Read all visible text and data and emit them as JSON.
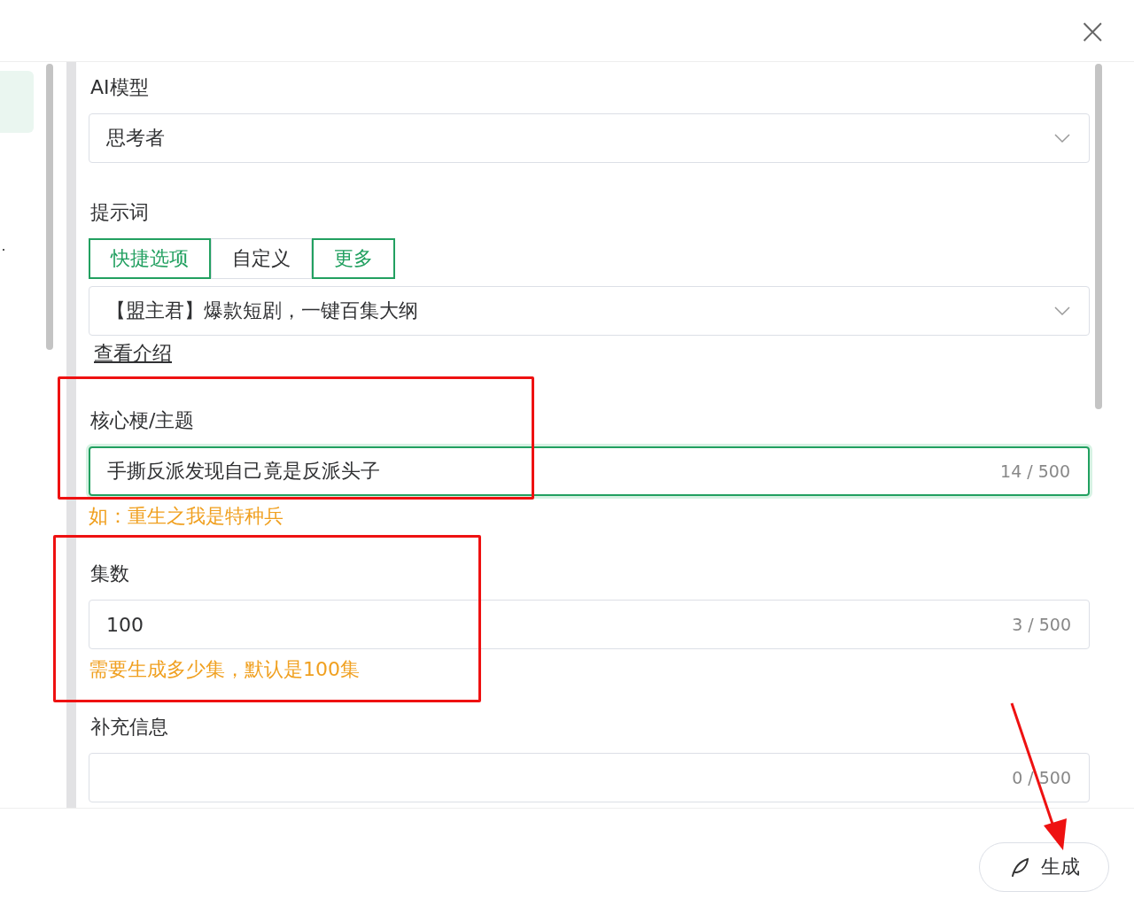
{
  "dialog": {
    "close": "×"
  },
  "sections": [
    {
      "kind": "select",
      "label": "AI模型",
      "value": "思考者"
    },
    {
      "kind": "prompt",
      "label": "提示词",
      "tabs": [
        {
          "label": "快捷选项",
          "kind": "tab",
          "selected": true
        },
        {
          "label": "自定义",
          "kind": "tab",
          "selected": false
        },
        {
          "label": "更多",
          "kind": "more"
        }
      ],
      "value": "【盟主君】爆款短剧，一键百集大纲",
      "link": "查看介绍"
    },
    {
      "kind": "text",
      "label": "核心梗/主题",
      "value": "手撕反派发现自己竟是反派头子",
      "counter": "14 / 500",
      "focused": true,
      "hint": "如：重生之我是特种兵"
    },
    {
      "kind": "text",
      "label": "集数",
      "value": "100",
      "counter": "3 / 500",
      "focused": false,
      "hint": "需要生成多少集，默认是100集"
    },
    {
      "kind": "text",
      "label": "补充信息",
      "counter": "0 / 500",
      "focused": false
    }
  ],
  "footer": {
    "button": "生成"
  }
}
